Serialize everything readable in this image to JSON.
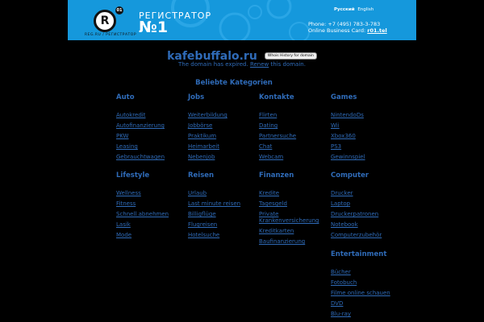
{
  "header": {
    "logo_mark": "R",
    "logo_sup": "01",
    "logo_subtitle": "REG.RU / РЕГИСТРАТОР",
    "logo_title": "РЕГИСТРАТОР",
    "logo_number": "№1",
    "lang_active": "Русский",
    "lang_other": "English",
    "phone": "Phone: +7 (495) 783-3-783",
    "card_prefix": "Online Business Card:",
    "card_link": "r01.tel"
  },
  "domain": {
    "name": "kafebuffalo.ru",
    "whois_button": "Whois History for domain",
    "expired_prefix": "The domain has expired.",
    "renew_link": "Renew",
    "expired_suffix": "this domain."
  },
  "categories_title": "Beliebte Kategorien",
  "categories": [
    {
      "title": "Auto",
      "links": [
        "Autokredit",
        "Autofinanzierung",
        "PKW",
        "Leasing",
        "Gebrauchtwagen"
      ]
    },
    {
      "title": "Jobs",
      "links": [
        "Weiterbildung",
        "Jobbörse",
        "Praktikum",
        "Heimarbeit",
        "Nebenjob"
      ]
    },
    {
      "title": "Kontakte",
      "links": [
        "Flirten",
        "Dating",
        "Partnersuche",
        "Chat",
        "Webcam"
      ]
    },
    {
      "title": "Games",
      "links": [
        "NintendoDs",
        "Wii",
        "Xbox360",
        "PS3",
        "Gewinnspiel"
      ]
    },
    {
      "title": "Lifestyle",
      "links": [
        "Wellness",
        "Fitness",
        "Schnell abnehmen",
        "Lasik",
        "Mode"
      ]
    },
    {
      "title": "Reisen",
      "links": [
        "Urlaub",
        "Last minute reisen",
        "Billigflüge",
        "Flugreisen",
        "Hotelsuche"
      ]
    },
    {
      "title": "Finanzen",
      "links": [
        "Kredite",
        "Tagesgeld",
        "Private Krankenversicherung",
        "Kreditkarten",
        "Baufinanzierung"
      ]
    },
    {
      "title": "Computer",
      "links": [
        "Drucker",
        "Laptop",
        "Druckerpatronen",
        "Notebook",
        "Computerzubehör"
      ]
    },
    {
      "title": "Entertainment",
      "links": [
        "Bücher",
        "Fotobuch",
        "Filme online schauen",
        "DVD",
        "Blu-ray"
      ]
    }
  ]
}
